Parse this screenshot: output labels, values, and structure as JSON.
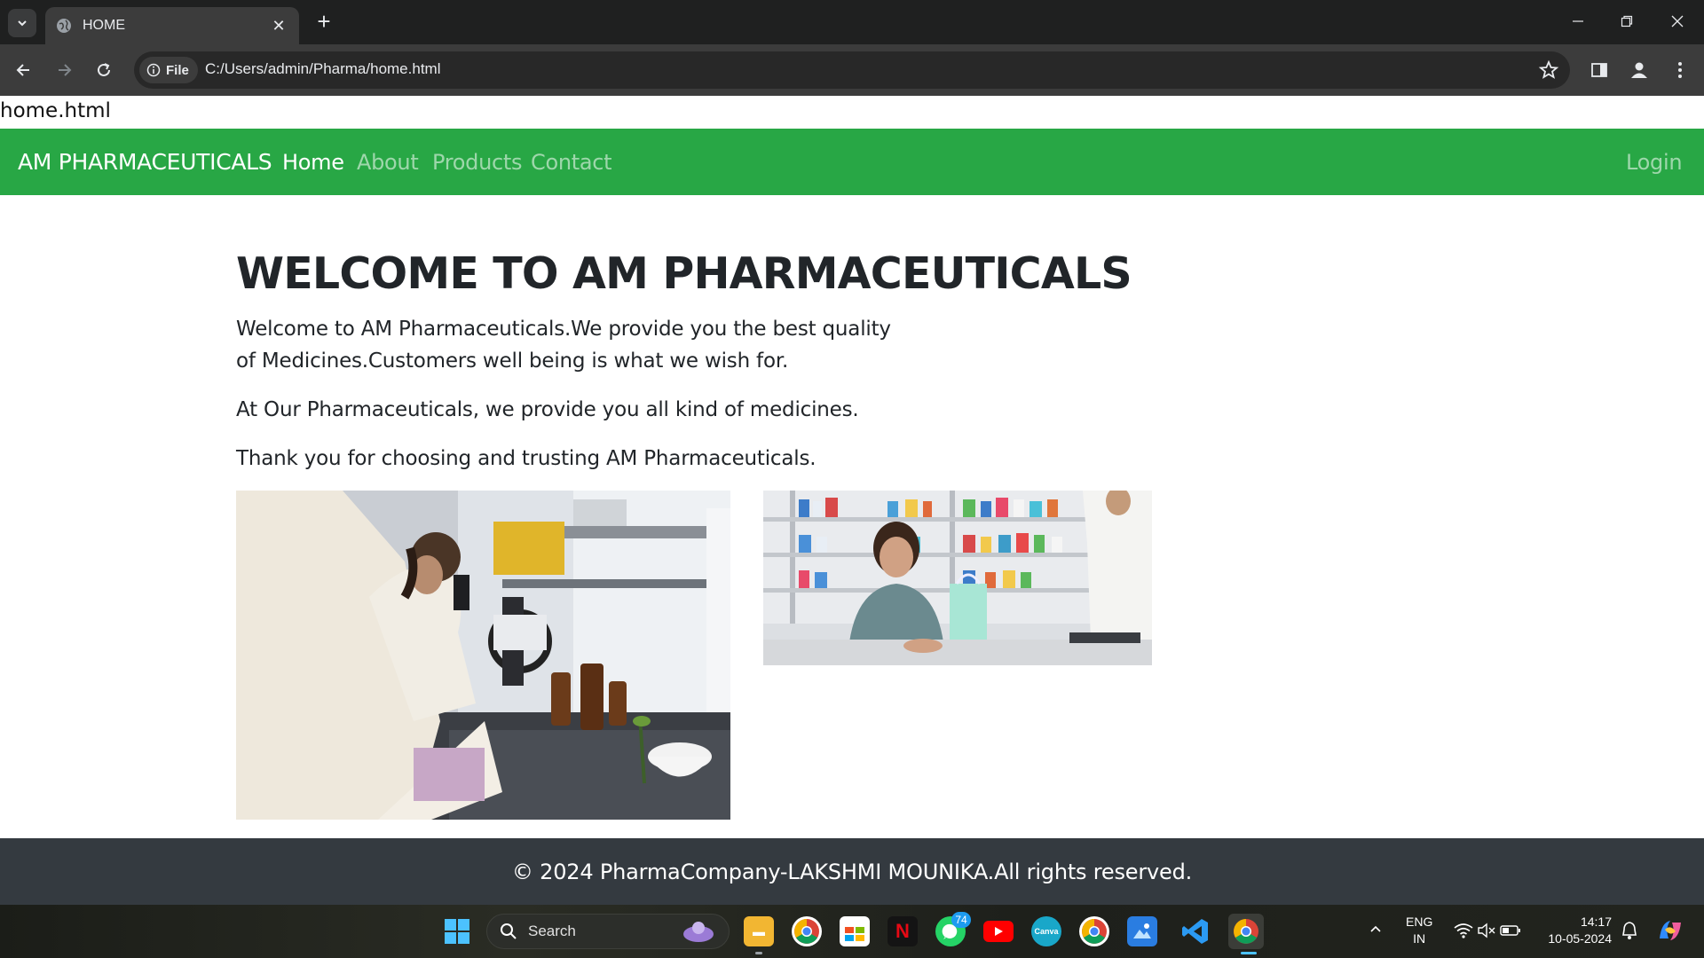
{
  "browser": {
    "tab_title": "HOME",
    "new_tab": "+",
    "file_chip": "File",
    "url": "C:/Users/admin/Pharma/home.html"
  },
  "page": {
    "filename_label": "home.html",
    "navbar": {
      "brand": "AM PHARMACEUTICALS",
      "links": [
        "Home",
        "About",
        "Products",
        "Contact"
      ],
      "login": "Login"
    },
    "headline": "WELCOME TO AM PHARMACEUTICALS",
    "paragraphs": [
      "Welcome to AM Pharmaceuticals.We provide you the best quality of Medicines.Customers well being is what we wish for.",
      "At Our Pharmaceuticals, we provide you all kind of medicines.",
      "Thank you for choosing and trusting AM Pharmaceuticals."
    ],
    "footer": "© 2024 PharmaCompany-LAKSHMI MOUNIKA.All rights reserved."
  },
  "taskbar": {
    "search": "Search",
    "whatsapp_badge": "74",
    "lang_top": "ENG",
    "lang_bottom": "IN",
    "time": "14:17",
    "date": "10-05-2024"
  },
  "colors": {
    "navbar": "#28a745",
    "footer": "#343a40",
    "chrome_dark": "#1f2020",
    "chrome_toolbar": "#3c3c3c"
  }
}
